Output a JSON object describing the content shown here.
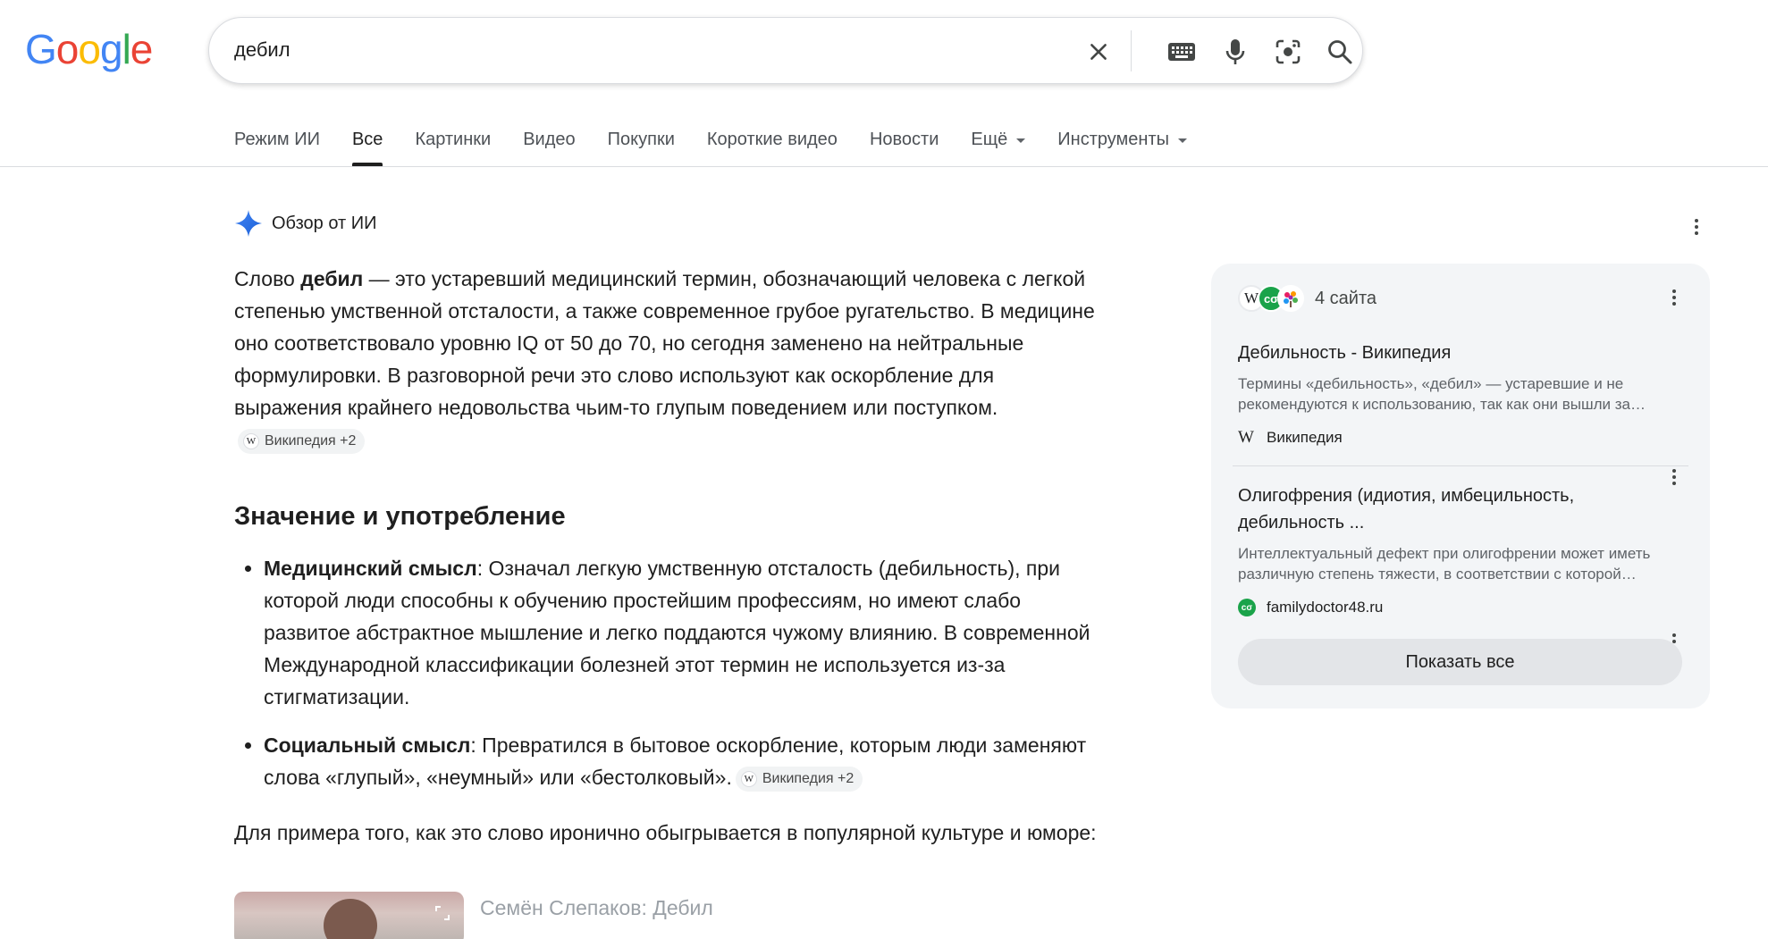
{
  "logo": {
    "text": "Google",
    "colors": [
      "#4285F4",
      "#EA4335",
      "#FBBC05",
      "#4285F4",
      "#34A853",
      "#EA4335"
    ]
  },
  "search": {
    "query": "дебил"
  },
  "tabs": [
    {
      "label": "Режим ИИ"
    },
    {
      "label": "Все",
      "active": true
    },
    {
      "label": "Картинки"
    },
    {
      "label": "Видео"
    },
    {
      "label": "Покупки"
    },
    {
      "label": "Короткие видео"
    },
    {
      "label": "Новости"
    },
    {
      "label": "Ещё",
      "dropdown": true
    },
    {
      "label": "Инструменты",
      "dropdown": true
    }
  ],
  "ai_overview": {
    "header": "Обзор от ИИ",
    "intro_pre": "Слово ",
    "intro_bold": "дебил",
    "intro_post": " — это устаревший медицинский термин, обозначающий человека с легкой степенью умственной отсталости, а также современное грубое ругательство. В медицине оно соответствовало уровню IQ от 50 до 70, но сегодня заменено на нейтральные формулировки. В разговорной речи это слово используют как оскорбление для выражения крайнего недовольства чьим-то глупым поведением или поступком.",
    "chip1": "Википедия +2",
    "heading": "Значение и употребление",
    "bullets": [
      {
        "bold": "Медицинский смысл",
        "text": ": Означал легкую умственную отсталость (дебильность), при которой люди способны к обучению простейшим профессиям, но имеют слабо развитое абстрактное мышление и легко поддаются чужому влиянию. В современной Международной классификации болезней этот термин не используется из-за стигматизации."
      },
      {
        "bold": "Социальный смысл",
        "text": ": Превратился в бытовое оскорбление, которым люди заменяют слова «глупый», «неумный» или «бестолковый».",
        "chip": "Википедия +2"
      }
    ],
    "para2": "Для примера того, как это слово иронично обыгрывается в популярной культуре и юморе:",
    "video_title": "Семён Слепаков: Дебил"
  },
  "sources": {
    "count_label": "4 сайта",
    "items": [
      {
        "title": "Дебильность - Википедия",
        "desc": "Термины «дебильность», «дебил» — устаревшие и не рекомендуются к использованию, так как они вышли за пределы медицинского контекста...",
        "site": "Википедия",
        "icon": "wikipedia-icon"
      },
      {
        "title": "Олигофрения (идиотия, имбецильность, дебильность ...",
        "desc": "Интеллектуальный дефект при олигофрении может иметь различную степень тяжести, в соответствии с которой выделяют...",
        "site": "familydoctor48.ru",
        "icon": "familydoctor-icon"
      }
    ],
    "show_all": "Показать все"
  }
}
